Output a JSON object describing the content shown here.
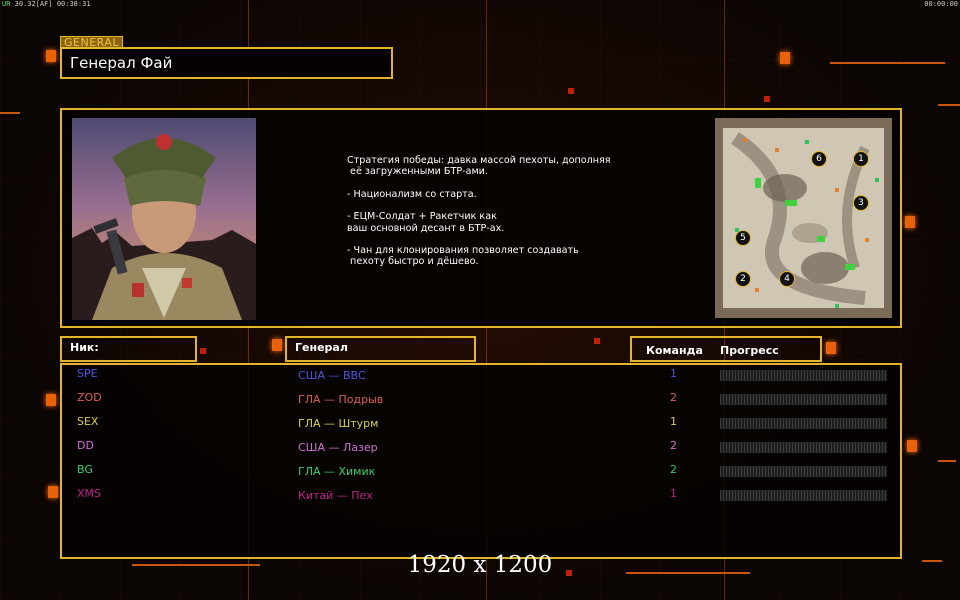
{
  "hud": {
    "left_prefix": "UR",
    "left_values": "30.32",
    "left_mid": "[AF]",
    "left_time": "00:38:31",
    "right_time": "00:00:00"
  },
  "general": {
    "tag": "GENERAL",
    "name": "Генерал Фай"
  },
  "description": [
    "Стратегия победы: давка массой пехоты, дополняя\n её загруженными БТР-ами.",
    "- Национализм со старта.",
    "- ЕЦМ-Солдат + Ракетчик как\nваш основной десант в БТР-ах.",
    "- Чан для клонирования позволяет создавать\n пехоту быстро и дёшево."
  ],
  "minimap": {
    "spawn_labels": [
      "6",
      "1",
      "3",
      "5",
      "2",
      "4"
    ]
  },
  "headers": {
    "nick": "Ник:",
    "general": "Генерал",
    "team": "Команда",
    "progress": "Прогресс"
  },
  "players": [
    {
      "nick": "SPE",
      "general": "США — ВВС",
      "team": "1",
      "progress": 0,
      "color": "#4a56e0"
    },
    {
      "nick": "ZOD",
      "general": "ГЛА — Подрыв",
      "team": "2",
      "progress": 0,
      "color": "#d86050"
    },
    {
      "nick": "SEX",
      "general": "ГЛА — Штурм",
      "team": "1",
      "progress": 0,
      "color": "#d8d04a"
    },
    {
      "nick": "DD",
      "general": "США — Лазер",
      "team": "2",
      "progress": 0,
      "color": "#d070d8"
    },
    {
      "nick": "BG",
      "general": "ГЛА — Химик",
      "team": "2",
      "progress": 0,
      "color": "#38d068"
    },
    {
      "nick": "XMS",
      "general": "Китай — Пех",
      "team": "1",
      "progress": 0,
      "color": "#c02090"
    }
  ],
  "resolution_label": "1920 x 1200",
  "colors": {
    "frame": "#e2b52a",
    "accent": "#e8620c"
  }
}
